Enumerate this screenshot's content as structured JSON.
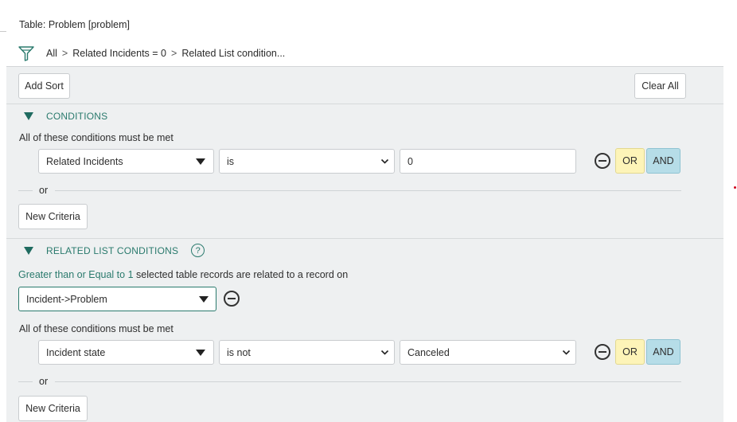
{
  "header": {
    "table_title": "Table: Problem [problem]",
    "breadcrumbs": [
      "All",
      "Related Incidents = 0",
      "Related List condition..."
    ],
    "separator": ">"
  },
  "sort_bar": {
    "add_sort_label": "Add Sort",
    "clear_all_label": "Clear All"
  },
  "conditions": {
    "title": "CONDITIONS",
    "must_be_met": "All of these conditions must be met",
    "row": {
      "field": "Related Incidents",
      "operator": "is",
      "value": "0"
    },
    "or_label": "OR",
    "and_label": "AND",
    "or_divider": "or",
    "new_criteria_label": "New Criteria"
  },
  "related_list": {
    "title": "RELATED LIST CONDITIONS",
    "help_glyph": "?",
    "quantifier_link": "Greater than or Equal to 1",
    "description": "selected table records are related to a record on",
    "relation_select": "Incident->Problem",
    "must_be_met": "All of these conditions must be met",
    "row": {
      "field": "Incident state",
      "operator": "is not",
      "value": "Canceled"
    },
    "or_label": "OR",
    "and_label": "AND",
    "or_divider": "or",
    "new_criteria_label": "New Criteria"
  },
  "colors": {
    "accent_green": "#2a7a6d",
    "or_yellow": "#fdf4b8",
    "and_blue": "#b6dde8",
    "panel_bg": "#eef0f1"
  }
}
